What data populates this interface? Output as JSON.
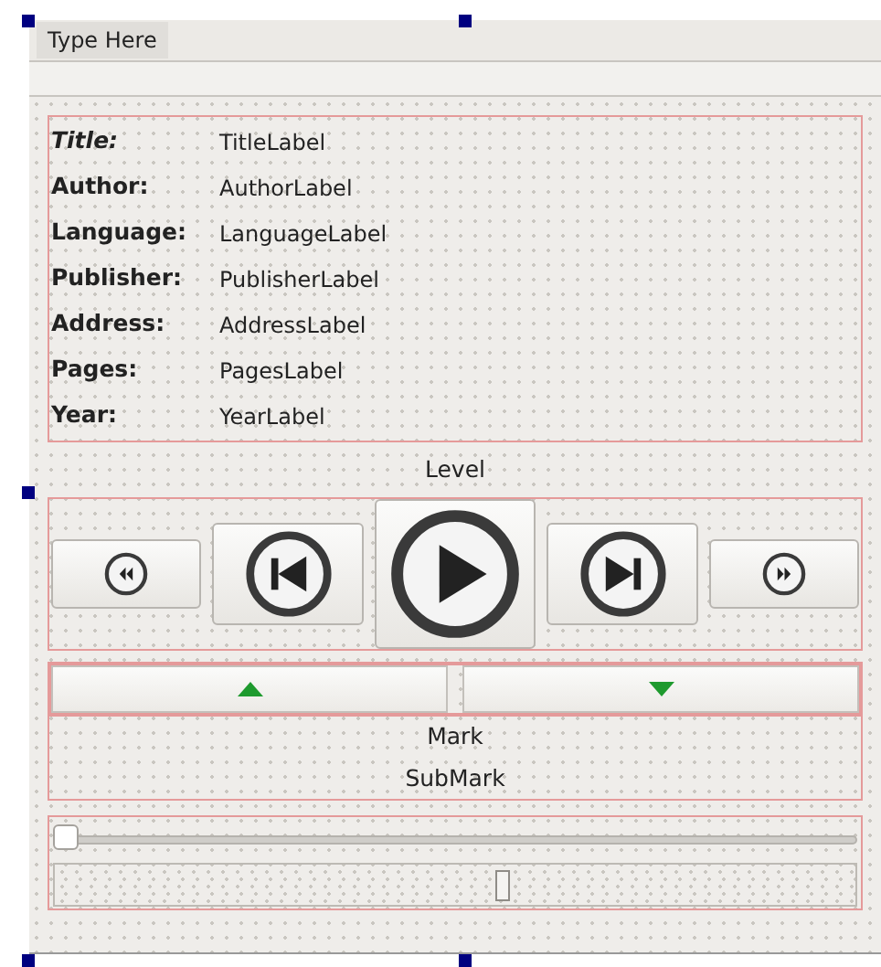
{
  "menu_bar": {
    "placeholder": "Type Here"
  },
  "fields": [
    {
      "label": "Title:",
      "value": "TitleLabel",
      "italic": true
    },
    {
      "label": "Author:",
      "value": "AuthorLabel",
      "italic": false
    },
    {
      "label": "Language:",
      "value": "LanguageLabel",
      "italic": false
    },
    {
      "label": "Publisher:",
      "value": "PublisherLabel",
      "italic": false
    },
    {
      "label": "Address:",
      "value": "AddressLabel",
      "italic": false
    },
    {
      "label": "Pages:",
      "value": "PagesLabel",
      "italic": false
    },
    {
      "label": "Year:",
      "value": "YearLabel",
      "italic": false
    }
  ],
  "level_label": "Level",
  "media_buttons": [
    {
      "kind": "rewind"
    },
    {
      "kind": "previous"
    },
    {
      "kind": "play"
    },
    {
      "kind": "next"
    },
    {
      "kind": "forward"
    }
  ],
  "splitter_buttons": [
    {
      "kind": "up"
    },
    {
      "kind": "down"
    }
  ],
  "mark_label": "Mark",
  "submark_label": "SubMark",
  "sliders": [
    {
      "kind": "slider",
      "level": 0
    },
    {
      "kind": "bar"
    }
  ]
}
